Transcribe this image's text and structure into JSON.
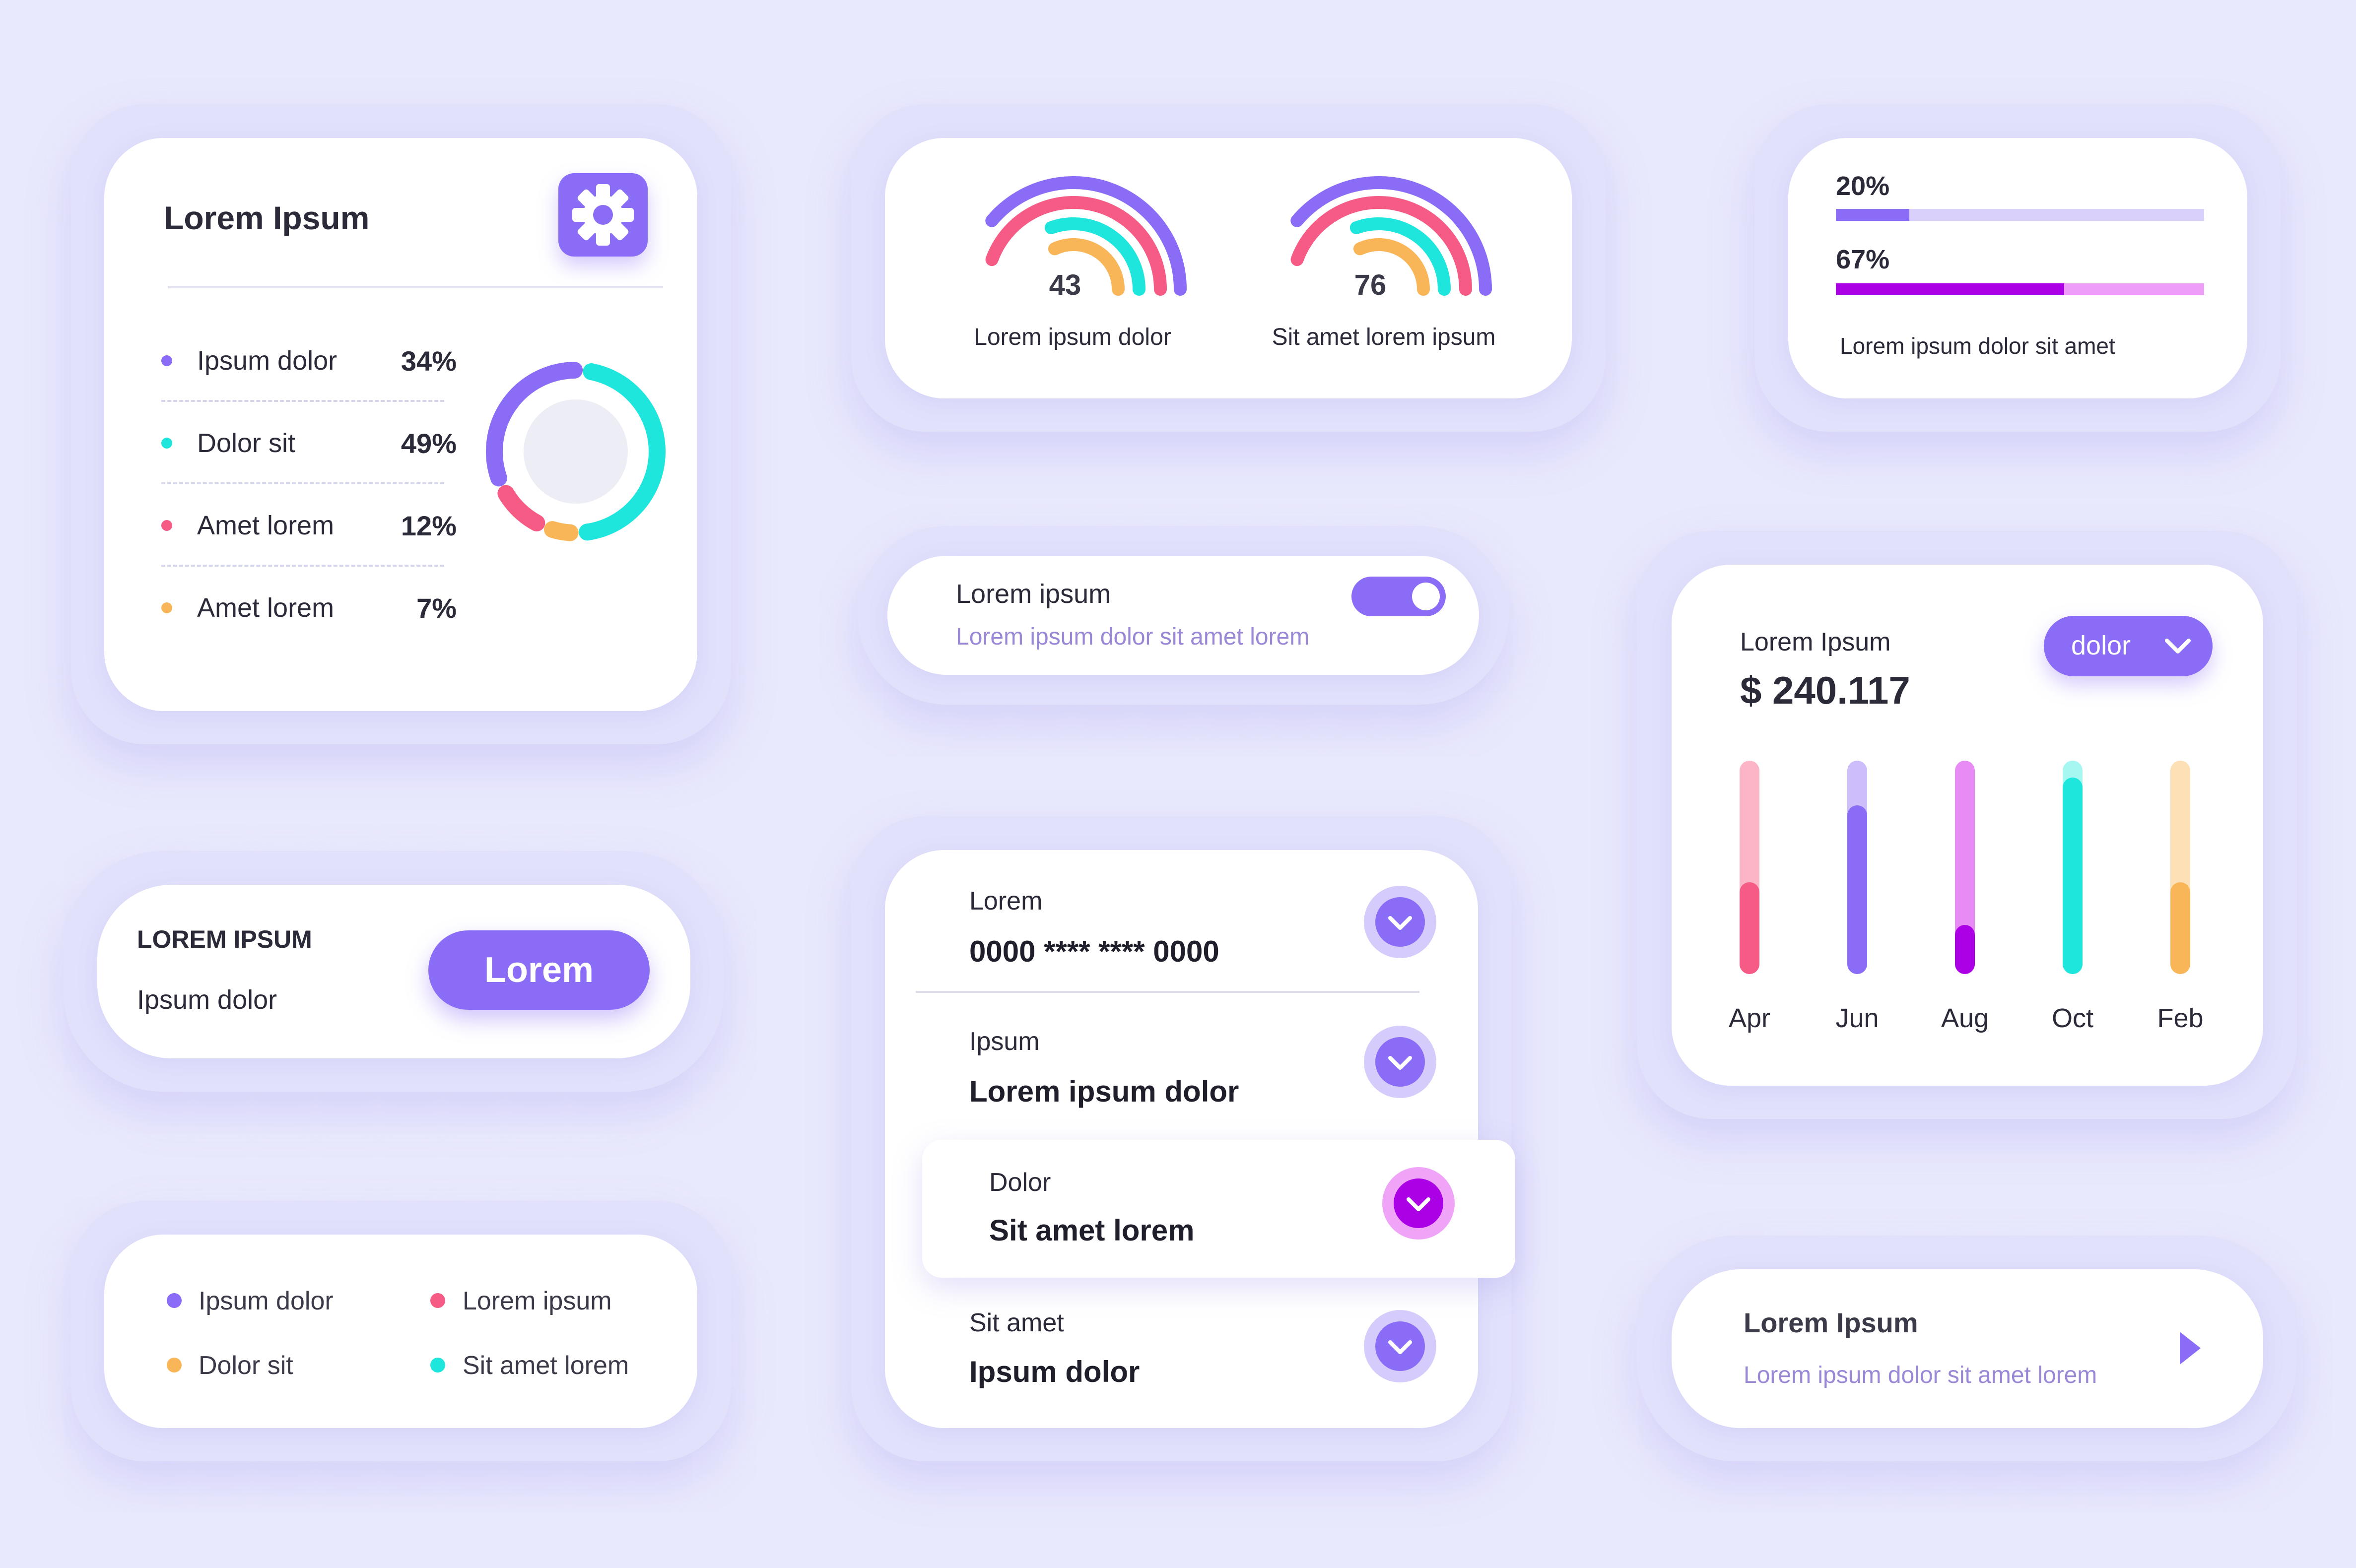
{
  "colors": {
    "background": "#e9e9fd",
    "purple": "#8b6cf6",
    "teal": "#1ee6dc",
    "pink": "#f55b85",
    "orange": "#f9b659",
    "magenta": "#ab00e6"
  },
  "stats_card": {
    "title": "Lorem Ipsum",
    "settings_icon": "gear-icon",
    "items": [
      {
        "label": "Ipsum dolor",
        "value": "34%",
        "color": "#8b6cf6"
      },
      {
        "label": "Dolor sit",
        "value": "49%",
        "color": "#1ee6dc"
      },
      {
        "label": "Amet lorem",
        "value": "12%",
        "color": "#f55b85"
      },
      {
        "label": "Amet lorem",
        "value": "7%",
        "color": "#f9b659"
      }
    ]
  },
  "gauges_card": {
    "gauges": [
      {
        "value": "43",
        "label": "Lorem ipsum dolor"
      },
      {
        "value": "76",
        "label": "Sit amet lorem ipsum"
      }
    ]
  },
  "progress_card": {
    "bars": [
      {
        "label": "20%",
        "fraction": 0.2,
        "color": "#8b6cf6",
        "track": "#d9d0fb"
      },
      {
        "label": "67%",
        "fraction": 0.62,
        "color": "#ab00e6",
        "track": "#ef9ef8"
      }
    ],
    "caption": "Lorem ipsum dolor sit amet"
  },
  "toggle_card": {
    "title": "Lorem ipsum",
    "subtitle": "Lorem ipsum dolor sit amet lorem",
    "on": true
  },
  "revenue_card": {
    "label": "Lorem Ipsum",
    "amount": "$ 240.117",
    "dropdown": "dolor",
    "months": [
      {
        "label": "Apr",
        "fill": 0.43,
        "track": "#fcb5c6",
        "color": "#f55b85"
      },
      {
        "label": "Jun",
        "fill": 0.79,
        "track": "#cdbdfb",
        "color": "#8b6cf6"
      },
      {
        "label": "Aug",
        "fill": 0.23,
        "track": "#e88bf5",
        "color": "#ab00e6"
      },
      {
        "label": "Oct",
        "fill": 0.92,
        "track": "#a6f7f1",
        "color": "#1ee6dc"
      },
      {
        "label": "Feb",
        "fill": 0.43,
        "track": "#fde0b5",
        "color": "#f9b659"
      }
    ]
  },
  "button_card": {
    "title": "LOREM IPSUM",
    "subtitle": "Ipsum dolor",
    "button": "Lorem"
  },
  "accordion_card": {
    "rows": [
      {
        "label": "Lorem",
        "value": "0000 **** **** 0000"
      },
      {
        "label": "Ipsum",
        "value": "Lorem ipsum dolor"
      },
      {
        "label": "Dolor",
        "value": "Sit amet lorem"
      },
      {
        "label": "Sit amet",
        "value": "Ipsum dolor"
      }
    ]
  },
  "legend_card": {
    "items": [
      {
        "label": "Ipsum dolor",
        "color": "#8b6cf6"
      },
      {
        "label": "Lorem ipsum",
        "color": "#f55b85"
      },
      {
        "label": "Dolor sit",
        "color": "#f9b659"
      },
      {
        "label": "Sit amet lorem",
        "color": "#1ee6dc"
      }
    ]
  },
  "link_card": {
    "title": "Lorem Ipsum",
    "subtitle": "Lorem ipsum dolor sit amet lorem",
    "arrow_icon": "play-arrow-icon"
  }
}
